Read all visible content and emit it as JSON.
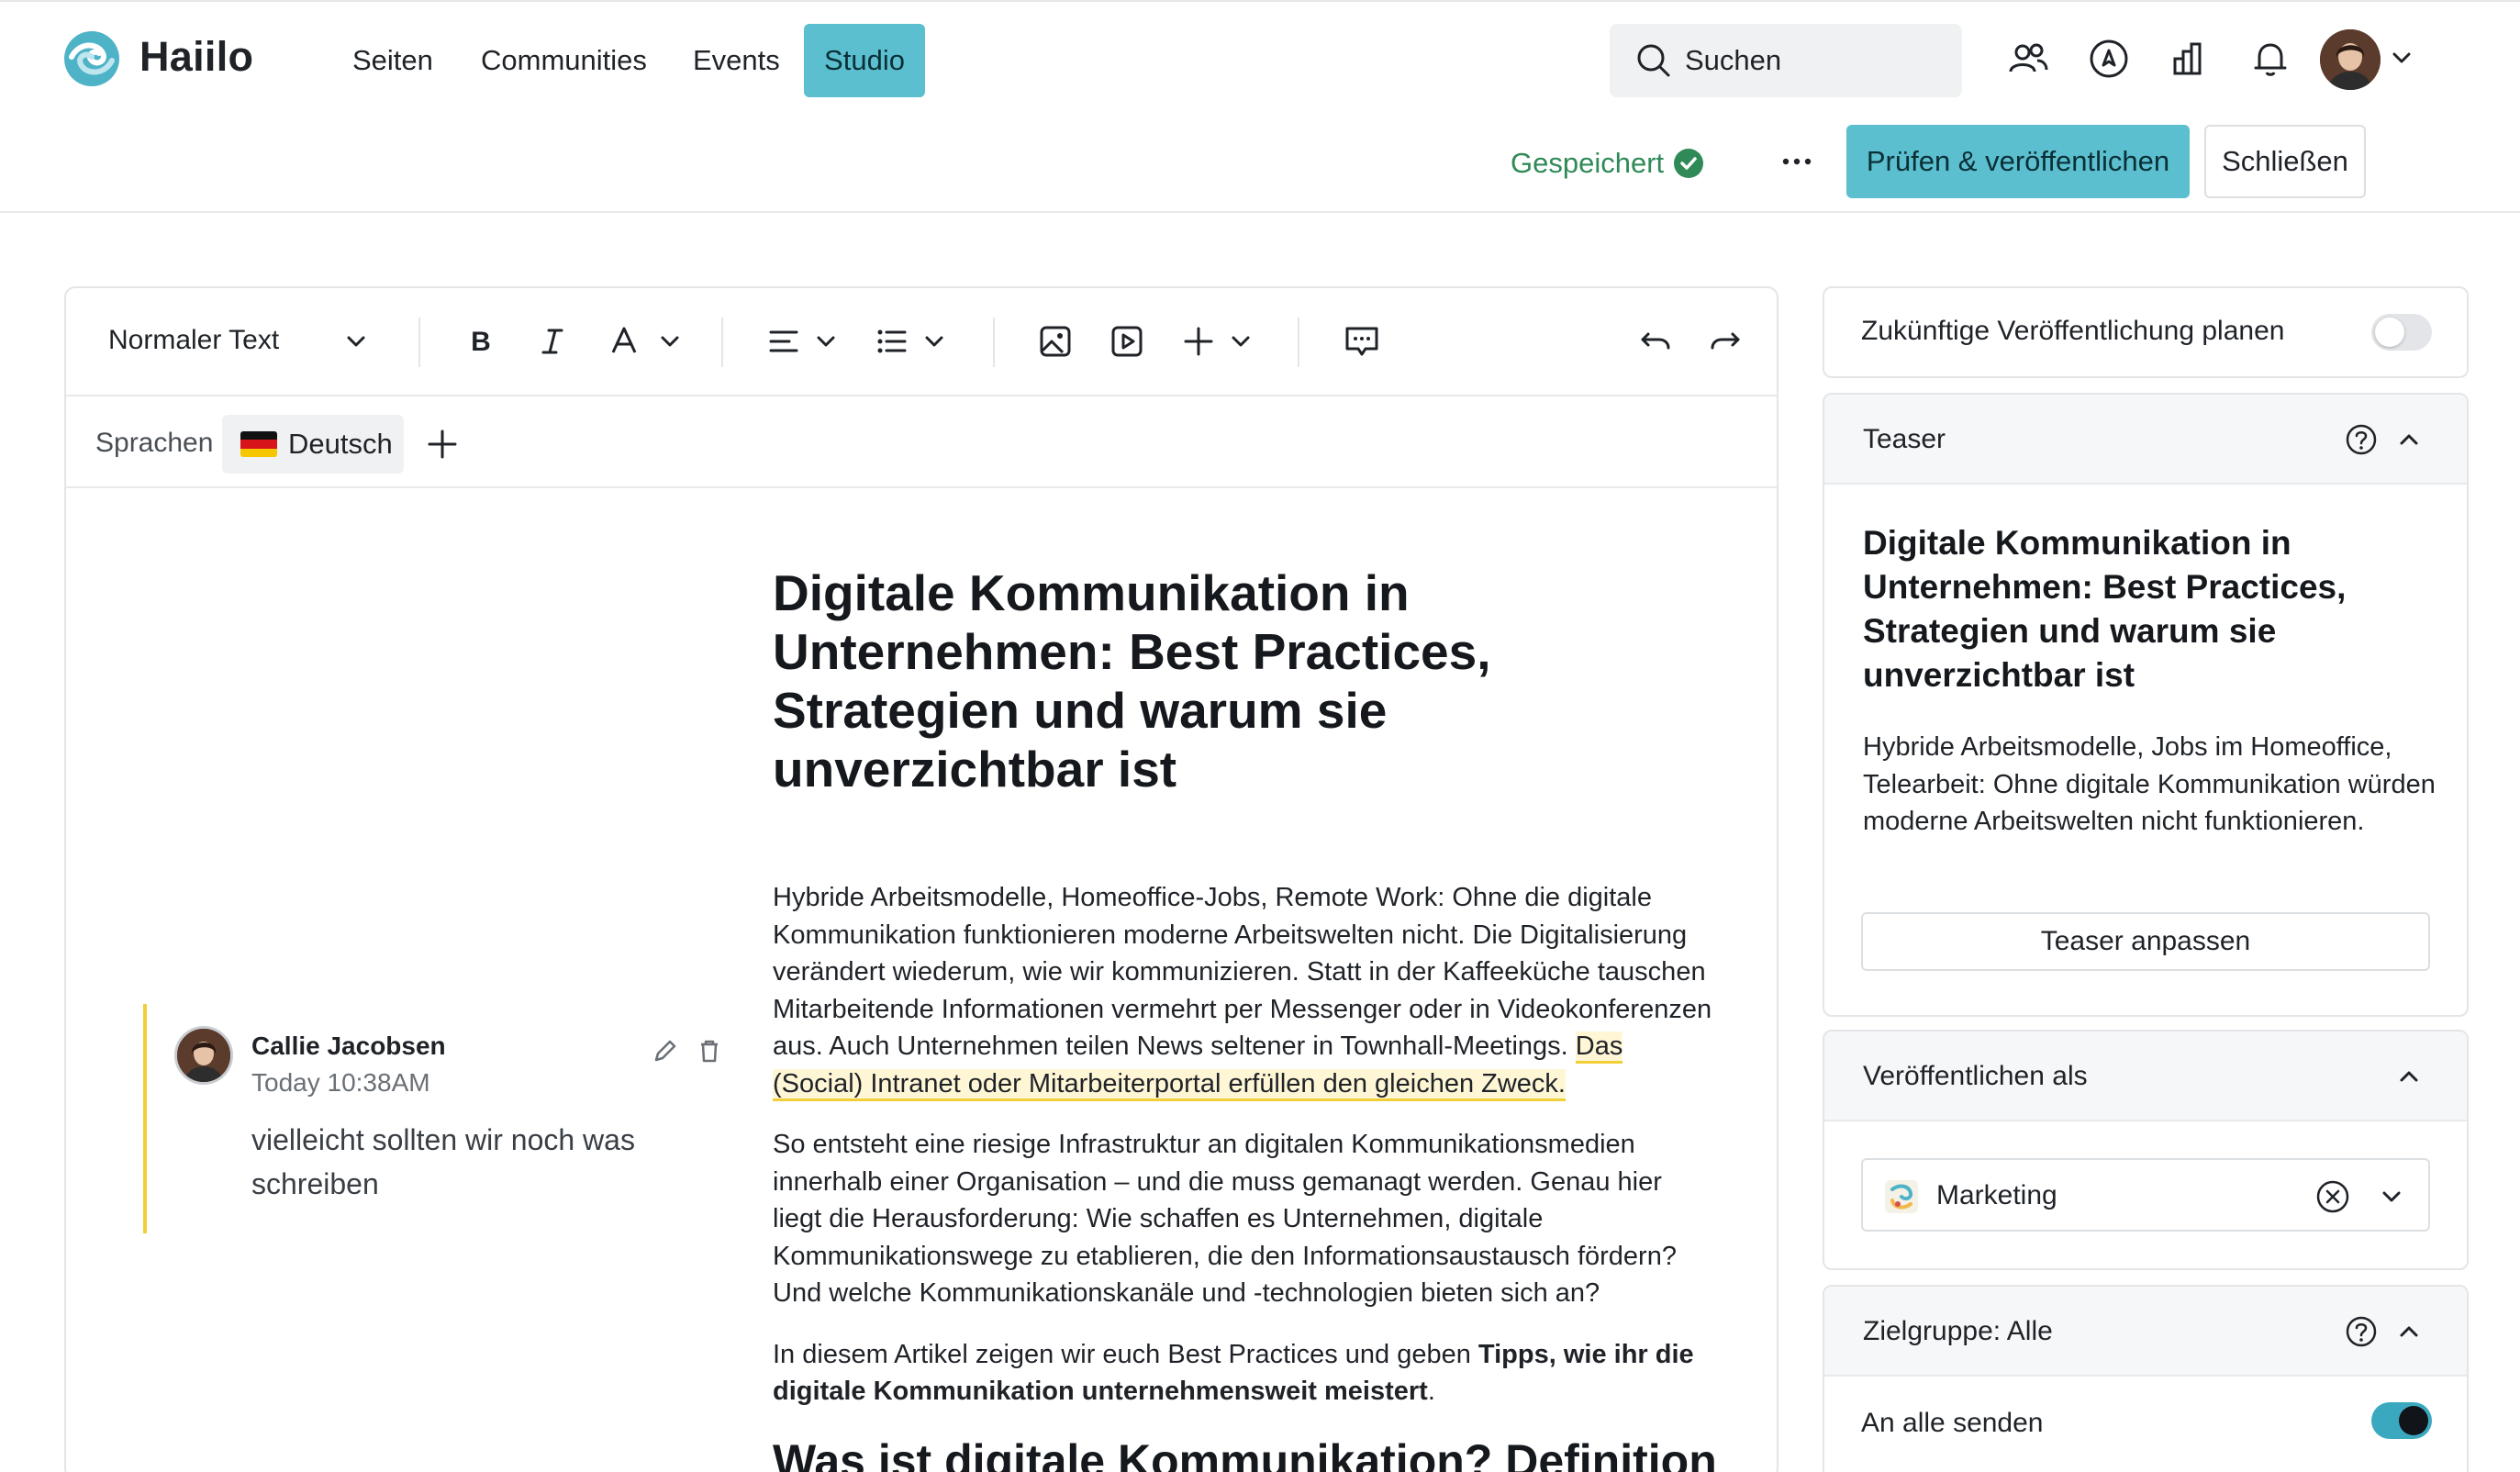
{
  "app": {
    "name": "Haiilo"
  },
  "nav": {
    "items": [
      "Seiten",
      "Communities",
      "Events"
    ],
    "active": "Studio",
    "search_placeholder": "Suchen"
  },
  "actions": {
    "saved_label": "Gespeichert",
    "publish_label": "Prüfen & veröffentlichen",
    "close_label": "Schließen"
  },
  "toolbar": {
    "text_style": "Normaler Text"
  },
  "languages": {
    "label": "Sprachen",
    "current": "Deutsch"
  },
  "article": {
    "title": "Digitale Kommunikation in Unternehmen: Best Practices, Strategien und warum sie unverzichtbar ist",
    "p1_plain": "Hybride Arbeitsmodelle, Homeoffice-Jobs, Remote Work: Ohne die digitale Kommunikation funktionieren moderne Arbeitswelten nicht. Die Digitalisierung verändert wiederum, wie wir kommunizieren. Statt in der Kaffeeküche tauschen Mitarbeitende Informationen vermehrt per Messenger oder in Videokonferenzen aus. Auch Unternehmen teilen News seltener in Townhall-Meetings. ",
    "p1_highlight": "Das (Social) Intranet oder Mitarbeiterportal erfüllen den gleichen Zweck.",
    "p2": "So entsteht eine riesige Infrastruktur an digitalen Kommunikationsmedien innerhalb einer Organisation – und die muss gemanagt werden. Genau hier liegt die Herausforderung: Wie schaffen es Unternehmen, digitale Kommunikationswege zu etablieren, die den Informationsaustausch fördern? Und welche Kommunikationskanäle und -technologien bieten sich an?",
    "p3_plain": "In diesem Artikel zeigen wir euch Best Practices und geben ",
    "p3_bold": "Tipps, wie ihr die digitale Kommunikation unternehmensweit meistert",
    "p3_end": ".",
    "h2": "Was ist digitale Kommunikation? Definition"
  },
  "comment": {
    "author": "Callie Jacobsen",
    "time": "Today 10:38AM",
    "text": "vielleicht sollten wir noch was schreiben"
  },
  "sidebar": {
    "schedule_label": "Zukünftige Veröffentlichung planen",
    "schedule_enabled": false,
    "teaser": {
      "heading": "Teaser",
      "title": "Digitale Kommunikation in Unternehmen: Best Practices, Strategien und warum sie unverzichtbar ist",
      "text": "Hybride Arbeitsmodelle, Jobs im Homeoffice, Telearbeit: Ohne digitale Kommunikation würden moderne Arbeitswelten nicht funktionieren.",
      "button": "Teaser anpassen"
    },
    "publish_as": {
      "heading": "Veröffentlichen als",
      "value": "Marketing"
    },
    "audience": {
      "heading": "Zielgruppe: Alle",
      "send_all_label": "An alle senden",
      "send_all_enabled": true
    }
  },
  "colors": {
    "accent": "#5bbfcf",
    "saved_green": "#2f8a57",
    "comment_highlight": "#f1cf3a",
    "toggle_on_track": "#3aa9c0"
  }
}
